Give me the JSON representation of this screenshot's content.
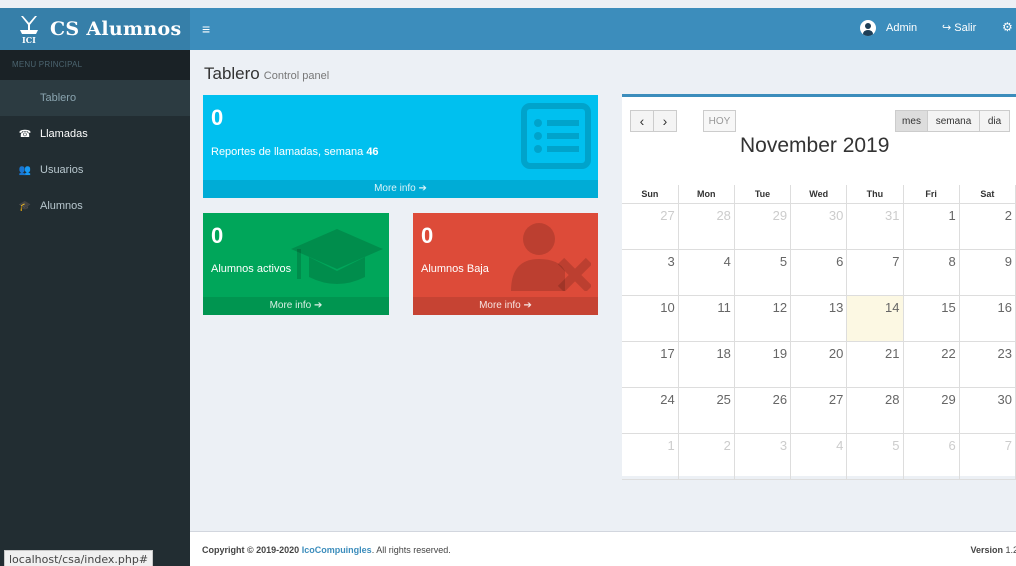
{
  "app": {
    "brand": "CS Alumnos",
    "toggle_icon": "hamburger-icon"
  },
  "topbar": {
    "user": "Admin",
    "logout": "Salir"
  },
  "sidebar": {
    "header": "MENU PRINCIPAL",
    "items": [
      {
        "label": "Tablero",
        "icon": "none"
      },
      {
        "label": "Llamadas",
        "icon": "phone-icon"
      },
      {
        "label": "Usuarios",
        "icon": "users-icon"
      },
      {
        "label": "Alumnos",
        "icon": "graduation-cap-icon"
      }
    ]
  },
  "page": {
    "title": "Tablero",
    "subtitle": "Control panel"
  },
  "boxes": {
    "calls": {
      "value": "0",
      "label": "Reportes de llamadas, semana",
      "week": "46",
      "more": "More info",
      "color": "#00c0ef"
    },
    "active": {
      "value": "0",
      "label": "Alumnos activos",
      "more": "More info",
      "color": "#00a65a"
    },
    "baja": {
      "value": "0",
      "label": "Alumnos Baja",
      "more": "More info",
      "color": "#dd4b39"
    }
  },
  "calendar": {
    "prev": "‹",
    "next": "›",
    "today": "HOY",
    "title": "November 2019",
    "views": [
      "mes",
      "semana",
      "dia"
    ],
    "weekdays": [
      "Sun",
      "Mon",
      "Tue",
      "Wed",
      "Thu",
      "Fri",
      "Sat"
    ],
    "weeks": [
      [
        "27",
        "28",
        "29",
        "30",
        "31",
        "1",
        "2"
      ],
      [
        "3",
        "4",
        "5",
        "6",
        "7",
        "8",
        "9"
      ],
      [
        "10",
        "11",
        "12",
        "13",
        "14",
        "15",
        "16"
      ],
      [
        "17",
        "18",
        "19",
        "20",
        "21",
        "22",
        "23"
      ],
      [
        "24",
        "25",
        "26",
        "27",
        "28",
        "29",
        "30"
      ],
      [
        "1",
        "2",
        "3",
        "4",
        "5",
        "6",
        "7"
      ]
    ]
  },
  "footer": {
    "copyright": "Copyright © 2019-2020",
    "company": "IcoCompuingles",
    "rights": ". All rights reserved.",
    "version_label": "Version",
    "version": "1.2"
  },
  "status_url": "localhost/csa/index.php#"
}
